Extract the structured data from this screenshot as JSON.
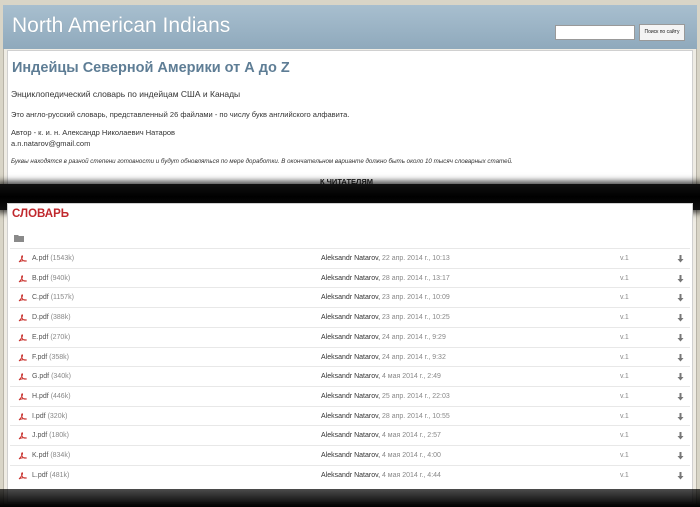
{
  "header": {
    "site_title": "North American Indians",
    "search_button": "Поиск по сайту"
  },
  "intro": {
    "title": "Индейцы Северной Америки от А до Z",
    "subtitle": "Энциклопедический словарь по индейцам США и Канады",
    "description": "Это англо-русский словарь, представленный 26 файлами - по числу букв английского алфавита.",
    "author": "Автор - к. и. н. Александр Николаевич Натаров",
    "email": "a.n.natarov@gmail.com",
    "note": "Буквы находятся в разной степени готовности и будут обновляться по мере доработки. В окончательном варианте должно быть около 10 тысяч словарных статей.",
    "readers_link": "К ЧИТАТЕЛЯМ"
  },
  "dictionary": {
    "title": "СЛОВАРЬ",
    "files": [
      {
        "name": "A.pdf",
        "size": "(1543k)",
        "author": "Aleksandr Natarov,",
        "date": "22 апр. 2014 г., 10:13",
        "version": "v.1"
      },
      {
        "name": "B.pdf",
        "size": "(940k)",
        "author": "Aleksandr Natarov,",
        "date": "28 апр. 2014 г., 13:17",
        "version": "v.1"
      },
      {
        "name": "C.pdf",
        "size": "(1157k)",
        "author": "Aleksandr Natarov,",
        "date": "23 апр. 2014 г., 10:09",
        "version": "v.1"
      },
      {
        "name": "D.pdf",
        "size": "(388k)",
        "author": "Aleksandr Natarov,",
        "date": "23 апр. 2014 г., 10:25",
        "version": "v.1"
      },
      {
        "name": "E.pdf",
        "size": "(270k)",
        "author": "Aleksandr Natarov,",
        "date": "24 апр. 2014 г., 9:29",
        "version": "v.1"
      },
      {
        "name": "F.pdf",
        "size": "(358k)",
        "author": "Aleksandr Natarov,",
        "date": "24 апр. 2014 г., 9:32",
        "version": "v.1"
      },
      {
        "name": "G.pdf",
        "size": "(340k)",
        "author": "Aleksandr Natarov,",
        "date": "4 мая 2014 г., 2:49",
        "version": "v.1"
      },
      {
        "name": "H.pdf",
        "size": "(446k)",
        "author": "Aleksandr Natarov,",
        "date": "25 апр. 2014 г., 22:03",
        "version": "v.1"
      },
      {
        "name": "I.pdf",
        "size": "(320k)",
        "author": "Aleksandr Natarov,",
        "date": "28 апр. 2014 г., 10:55",
        "version": "v.1"
      },
      {
        "name": "J.pdf",
        "size": "(180k)",
        "author": "Aleksandr Natarov,",
        "date": "4 мая 2014 г., 2:57",
        "version": "v.1"
      },
      {
        "name": "K.pdf",
        "size": "(834k)",
        "author": "Aleksandr Natarov,",
        "date": "4 мая 2014 г., 4:00",
        "version": "v.1"
      },
      {
        "name": "L.pdf",
        "size": "(481k)",
        "author": "Aleksandr Natarov,",
        "date": "4 мая 2014 г., 4:44",
        "version": "v.1"
      }
    ]
  },
  "colors": {
    "header_bg": "#9bb3c5",
    "title_blue": "#5e7d95",
    "dict_red": "#c0282d",
    "pdf_red": "#c9302c"
  },
  "icons": {
    "folder": "folder-icon",
    "pdf": "pdf-icon",
    "download": "download-icon"
  }
}
